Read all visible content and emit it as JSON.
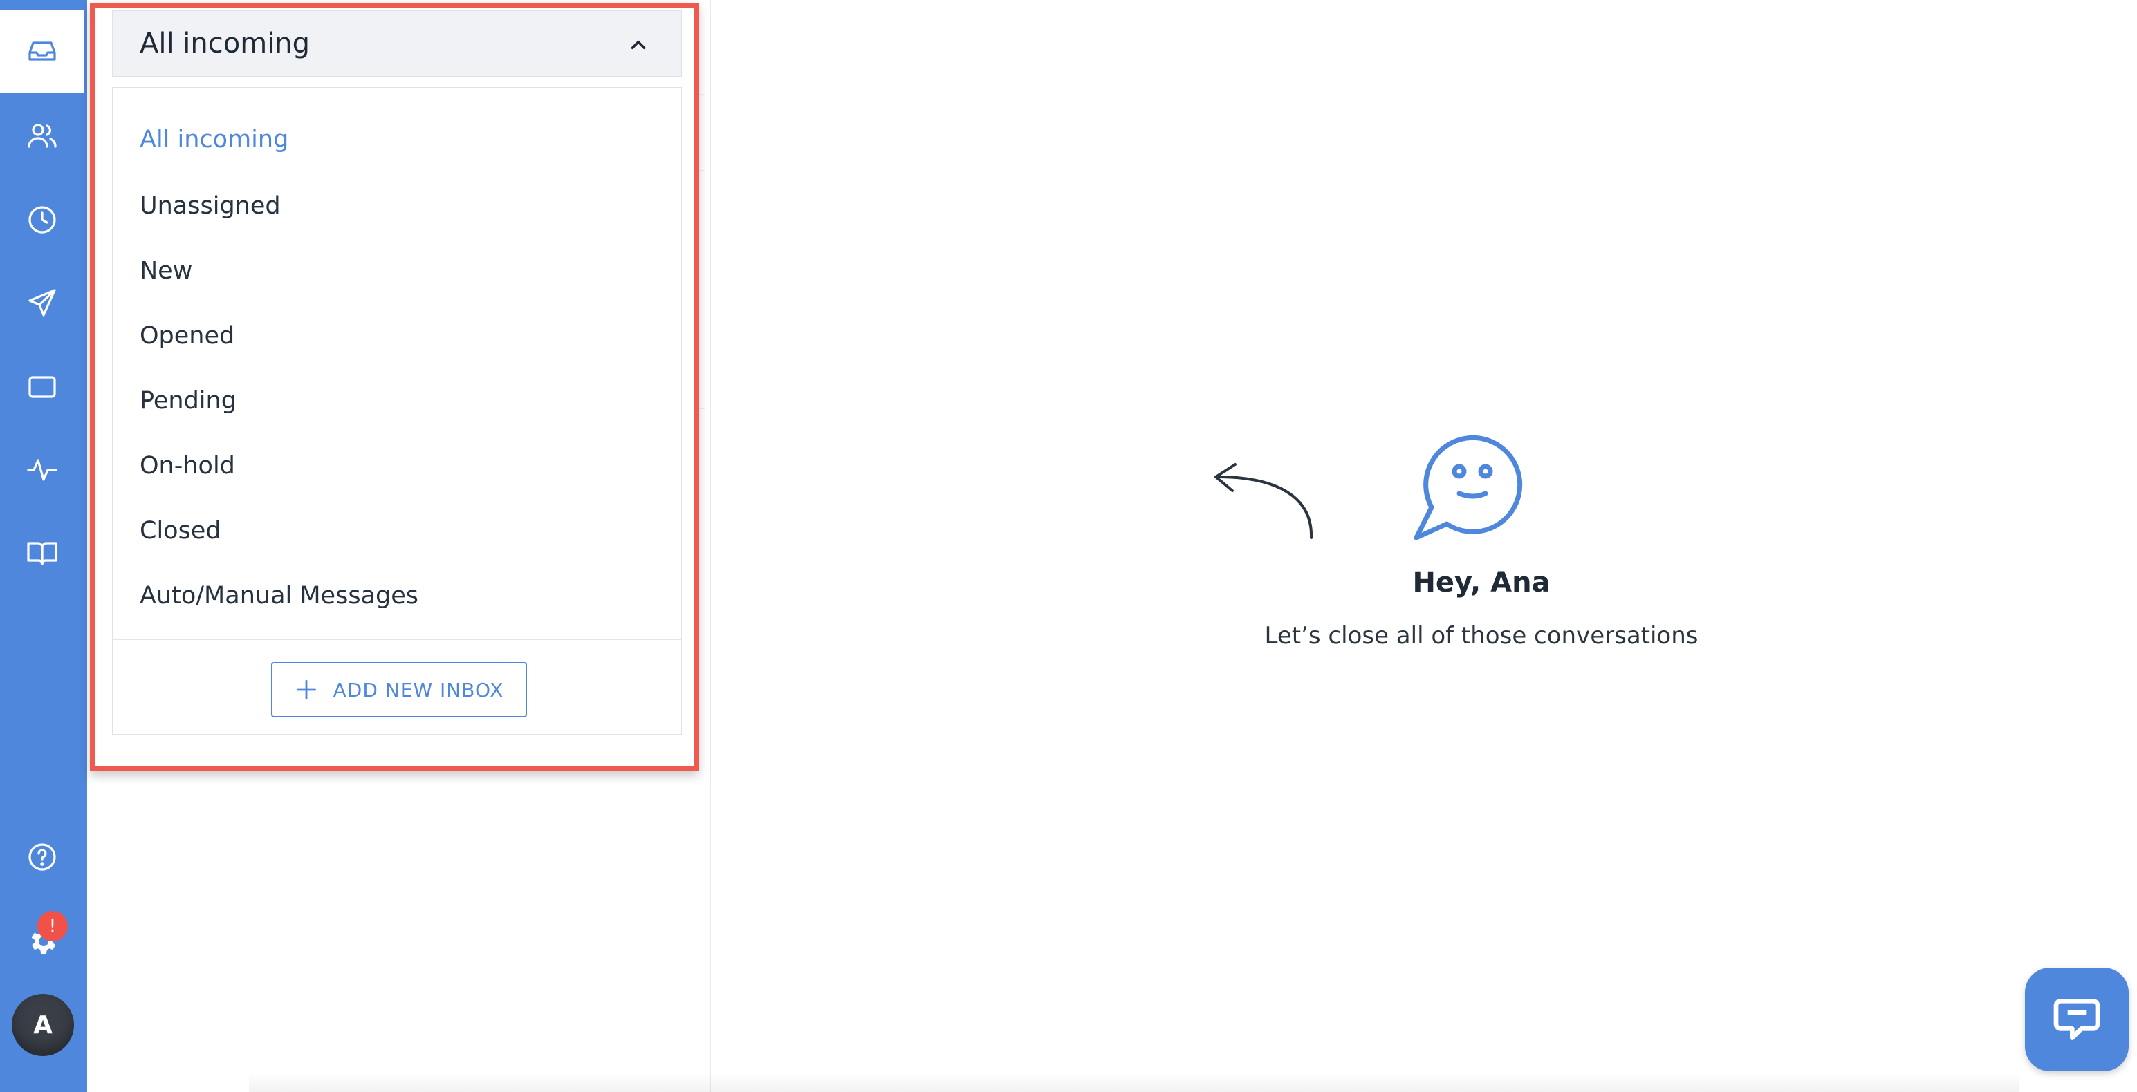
{
  "app": {
    "accent": "#4f87dc",
    "highlight": "#ef5a4e"
  },
  "nav": {
    "items": [
      {
        "name": "inbox",
        "icon": "inbox-icon",
        "active": true
      },
      {
        "name": "contacts",
        "icon": "users-icon"
      },
      {
        "name": "history",
        "icon": "clock-icon"
      },
      {
        "name": "campaigns",
        "icon": "send-icon"
      },
      {
        "name": "widget",
        "icon": "window-icon"
      },
      {
        "name": "analytics",
        "icon": "pulse-icon"
      },
      {
        "name": "knowledge-base",
        "icon": "book-icon"
      },
      {
        "name": "help",
        "icon": "help-icon"
      },
      {
        "name": "settings",
        "icon": "gear-icon"
      }
    ],
    "settings_badge": "!",
    "avatar_initial": "A"
  },
  "inbox_dropdown": {
    "selected": "All incoming",
    "options": [
      "All incoming",
      "Unassigned",
      "New",
      "Opened",
      "Pending",
      "On-hold",
      "Closed",
      "Auto/Manual Messages"
    ],
    "add_button_label": "ADD NEW INBOX"
  },
  "empty_state": {
    "greeting": "Hey, Ana",
    "message": "Let’s close all of those conversations"
  }
}
